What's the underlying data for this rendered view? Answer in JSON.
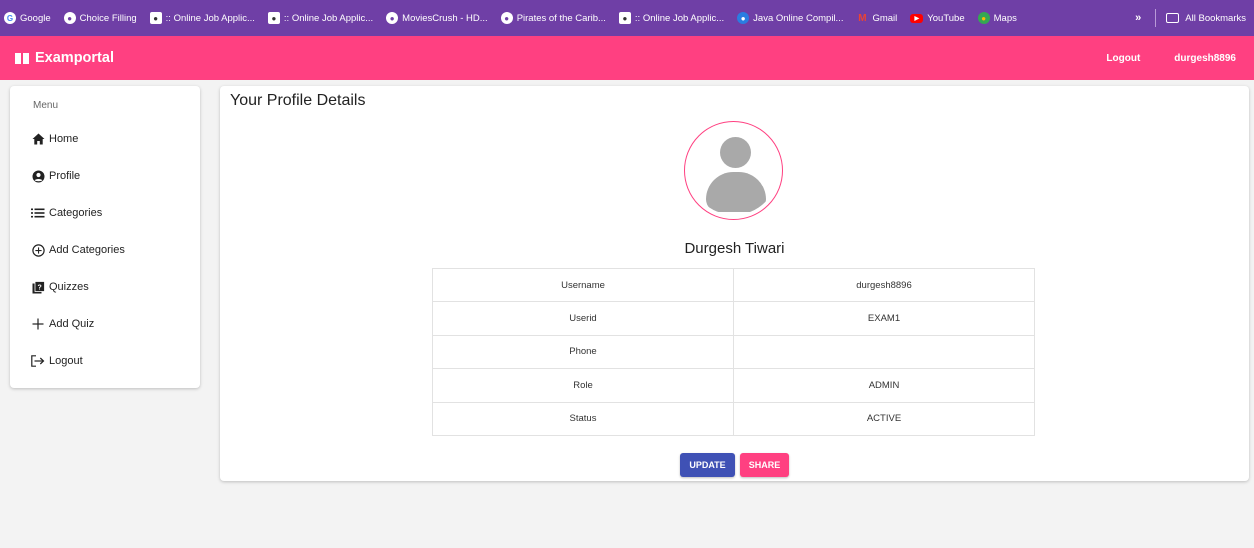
{
  "bookmarks": {
    "items": [
      {
        "label": "Google",
        "icon": "google-icon"
      },
      {
        "label": "Choice Filling",
        "icon": "globe-icon"
      },
      {
        "label": ":: Online Job Applic...",
        "icon": "job-icon"
      },
      {
        "label": ":: Online Job Applic...",
        "icon": "job-icon"
      },
      {
        "label": "MoviesCrush - HD...",
        "icon": "globe-icon"
      },
      {
        "label": "Pirates of the Carib...",
        "icon": "globe-icon"
      },
      {
        "label": ":: Online Job Applic...",
        "icon": "job-icon"
      },
      {
        "label": "Java Online Compil...",
        "icon": "java-icon"
      },
      {
        "label": "Gmail",
        "icon": "gmail-icon"
      },
      {
        "label": "YouTube",
        "icon": "youtube-icon"
      },
      {
        "label": "Maps",
        "icon": "maps-icon"
      }
    ],
    "more": "»",
    "all_bookmarks": "All Bookmarks"
  },
  "toolbar": {
    "brand": "Examportal",
    "logout": "Logout",
    "username": "durgesh8896"
  },
  "sidebar": {
    "title": "Menu",
    "items": [
      {
        "label": "Home",
        "icon": "home-icon"
      },
      {
        "label": "Profile",
        "icon": "account-circle-icon"
      },
      {
        "label": "Categories",
        "icon": "list-icon"
      },
      {
        "label": "Add Categories",
        "icon": "add-circle-icon"
      },
      {
        "label": "Quizzes",
        "icon": "quiz-icon"
      },
      {
        "label": "Add Quiz",
        "icon": "plus-icon"
      },
      {
        "label": "Logout",
        "icon": "logout-icon"
      }
    ]
  },
  "profile": {
    "title": "Your Profile Details",
    "full_name": "Durgesh Tiwari",
    "rows": [
      {
        "label": "Username",
        "value": "durgesh8896"
      },
      {
        "label": "Userid",
        "value": "EXAM1"
      },
      {
        "label": "Phone",
        "value": ""
      },
      {
        "label": "Role",
        "value": "ADMIN"
      },
      {
        "label": "Status",
        "value": "ACTIVE"
      }
    ],
    "update_label": "UPDATE",
    "share_label": "SHARE"
  },
  "colors": {
    "bookmarks_bar": "#6f3fa6",
    "toolbar": "#ff4081",
    "update_button": "#3f51b5",
    "share_button": "#ff4081"
  }
}
